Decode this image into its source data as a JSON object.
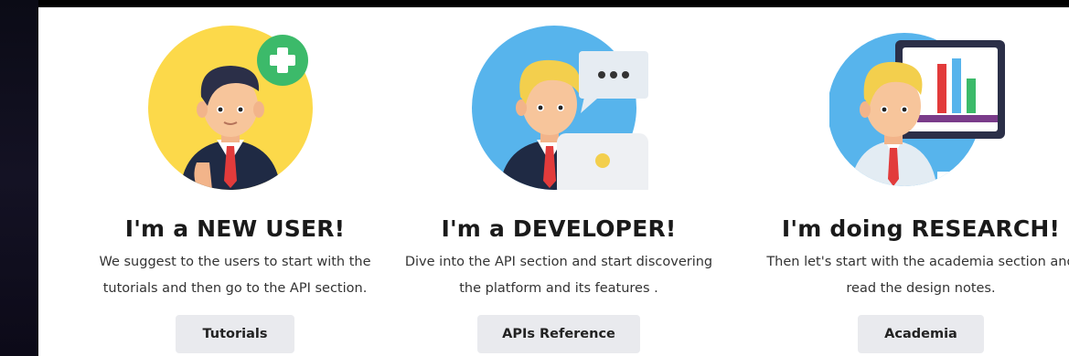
{
  "cards": [
    {
      "title": "I'm a NEW USER!",
      "desc_line1": "We suggest to the users to start with the",
      "desc_line2": "tutorials and then go to the API section.",
      "button": "Tutorials",
      "illustration": "new-user-illustration"
    },
    {
      "title": "I'm a DEVELOPER!",
      "desc_line1": "Dive into the API section and start discovering",
      "desc_line2": "the platform and its features .",
      "button": "APIs Reference",
      "illustration": "developer-illustration"
    },
    {
      "title": "I'm doing RESEARCH!",
      "desc_line1": "Then let's start with the academia section and",
      "desc_line2": "read the design notes.",
      "button": "Academia",
      "illustration": "researcher-illustration"
    }
  ],
  "colors": {
    "yellow_bg": "#fcd94a",
    "blue_bg": "#57b4ec",
    "green_plus": "#3cba6a",
    "button_bg": "#e9eaee"
  }
}
